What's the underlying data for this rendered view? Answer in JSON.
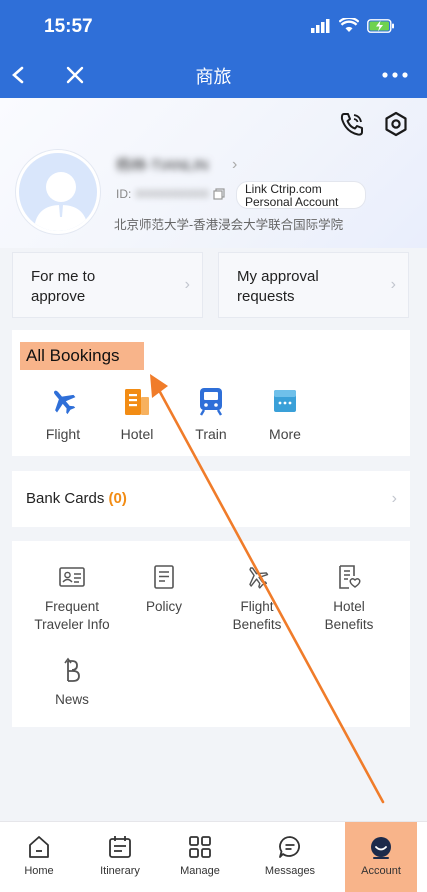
{
  "status_bar": {
    "time": "15:57"
  },
  "nav": {
    "title": "商旅"
  },
  "profile": {
    "name": "杨林-TIANLIN",
    "id_label": "ID:",
    "id_value": "00000000000",
    "account_badge_line1": "Link Ctrip.com",
    "account_badge_line2": "Personal Account",
    "school": "北京师范大学-香港浸会大学联合国际学院"
  },
  "approvals": {
    "for_me": [
      "For me to",
      "approve"
    ],
    "my_requests": [
      "My approval",
      "requests"
    ]
  },
  "bookings": {
    "title": "All Bookings",
    "items": [
      {
        "label": "Flight",
        "icon": "airplane-icon"
      },
      {
        "label": "Hotel",
        "icon": "hotel-building-icon"
      },
      {
        "label": "Train",
        "icon": "train-icon"
      },
      {
        "label": "More",
        "icon": "more-grid-icon"
      }
    ]
  },
  "bank_cards": {
    "label": "Bank Cards",
    "count": "(0)"
  },
  "services": [
    {
      "label": [
        "Frequent",
        "Traveler Info"
      ],
      "icon": "id-card-icon"
    },
    {
      "label": [
        "Policy"
      ],
      "icon": "document-icon"
    },
    {
      "label": [
        "Flight",
        "Benefits"
      ],
      "icon": "flight-benefit-icon"
    },
    {
      "label": [
        "Hotel",
        "Benefits"
      ],
      "icon": "hotel-benefit-icon"
    },
    {
      "label": [
        "News"
      ],
      "icon": "news-icon"
    }
  ],
  "tabbar": [
    {
      "label": "Home",
      "icon": "home-icon"
    },
    {
      "label": "Itinerary",
      "icon": "calendar-icon"
    },
    {
      "label": "Manage",
      "icon": "grid-icon"
    },
    {
      "label": "Messages",
      "icon": "chat-icon"
    },
    {
      "label": "Account",
      "icon": "account-icon",
      "active": true
    }
  ],
  "colors": {
    "brand_blue": "#2f6fd8",
    "accent_orange": "#f28c14",
    "highlight": "#f8b48a",
    "annotation_arrow": "#f07c2a"
  }
}
